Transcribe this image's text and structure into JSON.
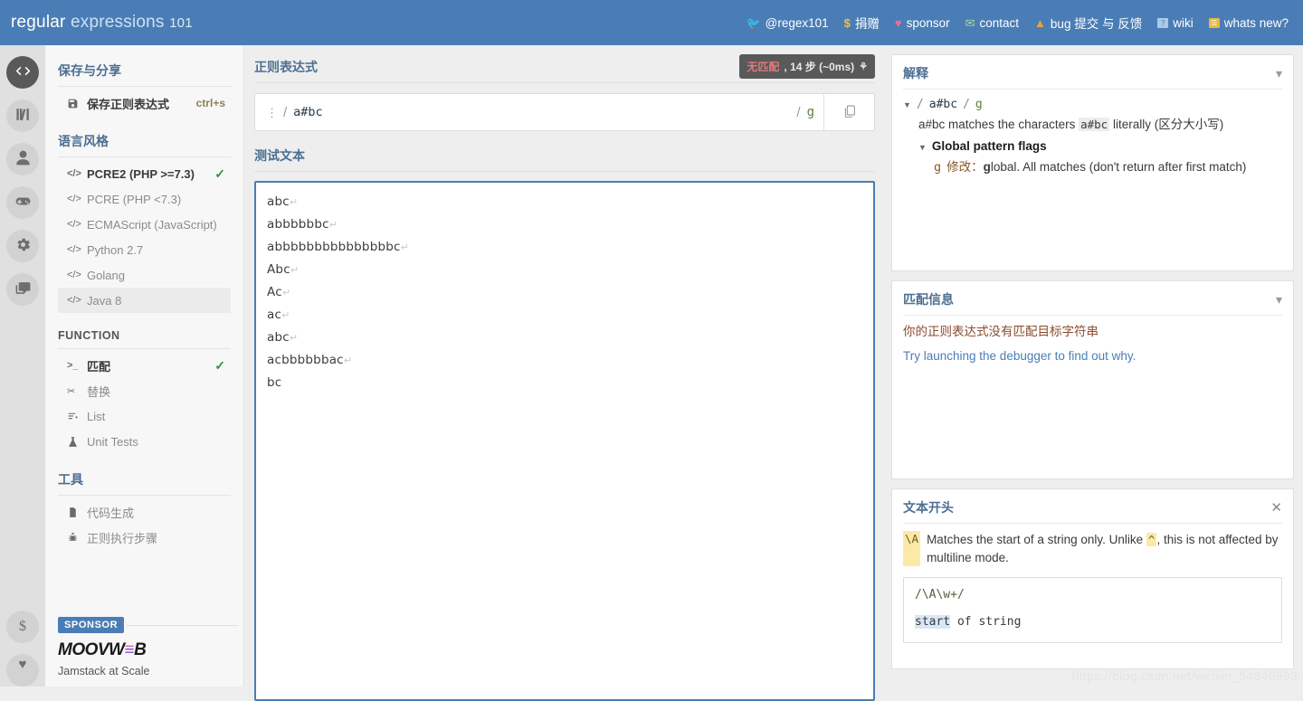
{
  "header": {
    "logo_bold": "regular",
    "logo_light": "expressions",
    "logo_num": "101",
    "nav": [
      {
        "label": "@regex101",
        "icon": "twitter-icon"
      },
      {
        "label": "捐赠",
        "icon": "dollar-icon"
      },
      {
        "label": "sponsor",
        "icon": "heart-icon"
      },
      {
        "label": "contact",
        "icon": "mail-icon"
      },
      {
        "label": "bug 提交 与 反馈",
        "icon": "bug-icon"
      },
      {
        "label": "wiki",
        "icon": "wiki-icon"
      },
      {
        "label": "whats new?",
        "icon": "news-icon"
      }
    ]
  },
  "rail": {
    "items": [
      {
        "name": "code-icon",
        "active": true
      },
      {
        "name": "library-icon",
        "active": false
      },
      {
        "name": "account-icon",
        "active": false
      },
      {
        "name": "gamepad-icon",
        "active": false
      },
      {
        "name": "gear-icon",
        "active": false
      },
      {
        "name": "chat-icon",
        "active": false
      }
    ],
    "bottom": [
      {
        "name": "dollar-icon"
      },
      {
        "name": "heart-icon"
      }
    ]
  },
  "sidebar": {
    "save_share_heading": "保存与分享",
    "save_item": {
      "label": "保存正则表达式",
      "shortcut": "ctrl+s",
      "icon": "save-icon"
    },
    "flavor_heading": "语言风格",
    "flavors": [
      {
        "label": "PCRE2 (PHP >=7.3)",
        "selected": true,
        "checked": true
      },
      {
        "label": "PCRE (PHP <7.3)",
        "selected": false,
        "checked": false
      },
      {
        "label": "ECMAScript (JavaScript)",
        "selected": false,
        "checked": false
      },
      {
        "label": "Python 2.7",
        "selected": false,
        "checked": false
      },
      {
        "label": "Golang",
        "selected": false,
        "checked": false
      },
      {
        "label": "Java 8",
        "selected": false,
        "checked": false,
        "hover": true
      }
    ],
    "function_heading": "FUNCTION",
    "functions": [
      {
        "label": "匹配",
        "icon": "terminal-icon",
        "checked": true,
        "active": true
      },
      {
        "label": "替换",
        "icon": "scissors-icon",
        "checked": false,
        "active": false
      },
      {
        "label": "List",
        "icon": "list-icon",
        "checked": false,
        "active": false
      },
      {
        "label": "Unit Tests",
        "icon": "flask-icon",
        "checked": false,
        "active": false
      }
    ],
    "tools_heading": "工具",
    "tools": [
      {
        "label": "代码生成",
        "icon": "code-file-icon"
      },
      {
        "label": "正则执行步骤",
        "icon": "debug-bug-icon"
      }
    ],
    "sponsor": {
      "tag": "SPONSOR",
      "name_a": "MOOVW",
      "name_e": "≡",
      "name_b": "B",
      "tagline": "Jamstack at Scale"
    }
  },
  "editor": {
    "regex_heading": "正则表达式",
    "match_badge": {
      "status": "无匹配",
      "steps": ", 14 步 (~0ms)",
      "icon": "debug-icon"
    },
    "open_slash": "/",
    "pattern": "a#bc",
    "close_slash": "/",
    "flags": "g",
    "copy_icon": "copy-icon",
    "grip_icon": "drag-handle-icon",
    "test_heading": "测试文本",
    "test_lines": [
      "abc",
      "abbbbbbc",
      "abbbbbbbbbbbbbbbc",
      "Abc",
      "Ac",
      "ac",
      "abc",
      "acbbbbbbac",
      "bc"
    ],
    "pilcrow": "↵",
    "last_line_has_break": false
  },
  "explanation": {
    "title": "解释",
    "collapse_icon": "chevron-down-icon",
    "pattern_row": {
      "caret": "▼",
      "slash1": "/",
      "pattern": "a#bc",
      "slash2": "/",
      "flags": "g"
    },
    "description_pre": "a#bc matches the characters ",
    "description_token": "a#bc",
    "description_post": " literally (区分大小写)",
    "flags_heading": {
      "caret": "▼",
      "label": "Global pattern flags"
    },
    "flag_entry": {
      "flag": "g",
      "modifier_label": "修改：",
      "bold_letter": "g",
      "text": "lobal. All matches (don't return after first match)"
    }
  },
  "match_info": {
    "title": "匹配信息",
    "collapse_icon": "chevron-down-icon",
    "no_match_text": "你的正则表达式没有匹配目标字符串",
    "debug_link": "Try launching the debugger to find out why."
  },
  "quick_ref": {
    "title": "文本开头",
    "close_icon": "close-icon",
    "token": "\\A",
    "desc_pre": "Matches the start of a string only. Unlike ",
    "desc_token": "^",
    "desc_post": ", this is not affected by multiline mode.",
    "code_pattern": "/\\A\\w+/",
    "code_result_hl": "start",
    "code_result_rest": " of string"
  },
  "watermark": "https://blog.csdn.net/weixin_54646993"
}
